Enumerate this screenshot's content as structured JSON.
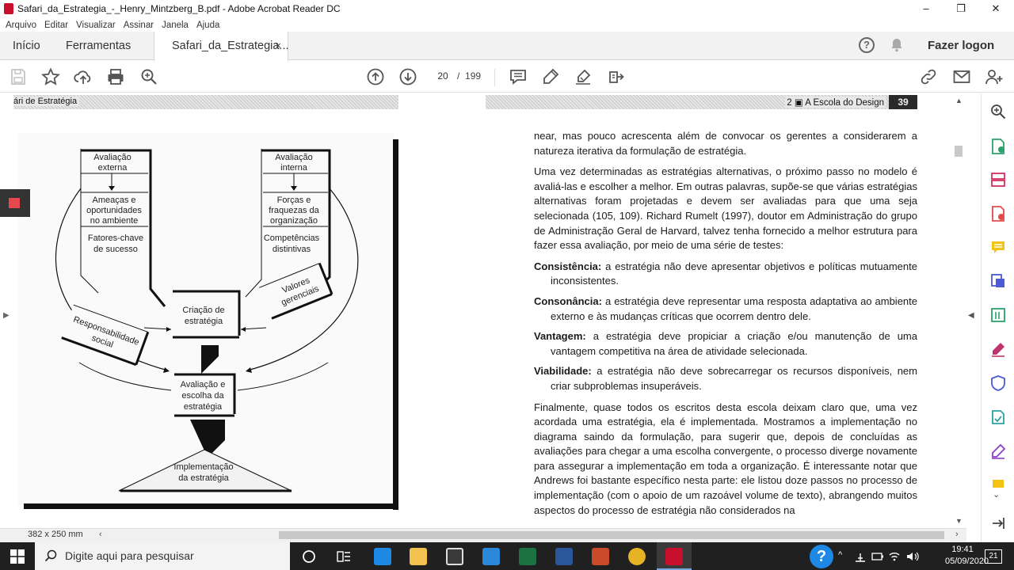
{
  "window": {
    "title": "Safari_da_Estrategia_-_Henry_Mintzberg_B.pdf - Adobe Acrobat Reader DC",
    "minimize": "–",
    "maximize": "❐",
    "close": "✕"
  },
  "menu": [
    "Arquivo",
    "Editar",
    "Visualizar",
    "Assinar",
    "Janela",
    "Ajuda"
  ],
  "tabs": {
    "home": "Início",
    "tools": "Ferramentas",
    "document": "Safari_da_Estrategia...",
    "close": "×",
    "help": "?",
    "login": "Fazer logon"
  },
  "toolbar": {
    "current_page": "20",
    "page_separator": "/",
    "total_pages": "199"
  },
  "document": {
    "left_running_head": "ári de Estratégia",
    "right_running_head": "2 ▣ A Escola do Design",
    "right_page_number": "39",
    "diagram": {
      "eval_external": [
        "Avaliação",
        "externa"
      ],
      "threats": [
        "Ameaças e",
        "oportunidades",
        "no ambiente"
      ],
      "key_factors": [
        "Fatores-chave",
        "de sucesso"
      ],
      "eval_internal": [
        "Avaliação",
        "interna"
      ],
      "strengths": [
        "Forças e",
        "fraquezas da",
        "organização"
      ],
      "competencies": [
        "Competências",
        "distintivas"
      ],
      "social": [
        "Responsabilidade",
        "social"
      ],
      "values": [
        "Valores",
        "gerenciais"
      ],
      "creation": [
        "Criação de",
        "estratégia"
      ],
      "evaluation": [
        "Avaliação e",
        "escolha da",
        "estratégia"
      ],
      "implementation": [
        "Implementação",
        "da estratégia"
      ]
    },
    "paragraphs": [
      "near, mas pouco acrescenta além de convocar os gerentes a considerarem a natureza iterativa da formulação de estratégia.",
      "Uma vez determinadas as estratégias alternativas, o próximo passo no modelo é avaliá-las e escolher a melhor. Em outras palavras, supõe-se que várias estratégias alternativas foram projetadas e devem ser avaliadas para que uma seja selecionada (105, 109). Richard Rumelt (1997), doutor em Administração do grupo de Administração Geral de Harvard, talvez tenha fornecido a melhor estrutura para fazer essa avaliação, por meio de uma série de testes:"
    ],
    "tests": [
      {
        "term": "Consistência:",
        "text": " a estratégia não deve apresentar objetivos e políticas mutuamente inconsistentes."
      },
      {
        "term": "Consonância:",
        "text": " a estratégia deve representar uma resposta adaptativa ao ambiente externo e às mudanças críticas que ocorrem dentro dele."
      },
      {
        "term": "Vantagem:",
        "text": " a estratégia deve propiciar a criação e/ou manutenção de uma vantagem competitiva na área de atividade selecionada."
      },
      {
        "term": "Viabilidade:",
        "text": " a estratégia não deve sobrecarregar os recursos disponíveis, nem criar subproblemas insuperáveis."
      }
    ],
    "final_paragraph": "Finalmente, quase todos os escritos desta escola deixam claro que, uma vez acordada uma estratégia, ela é implementada. Mostramos a implementação no diagrama saindo da formulação, para sugerir que, depois de concluídas as avaliações para chegar a uma escolha convergente, o processo diverge novamente para assegurar a implementação em toda a organização. É interessante notar que Andrews foi bastante específico nesta parte: ele listou doze passos no processo de implementação (com o apoio de um razoável volume de texto), abrangendo muitos aspectos do processo de estratégia não considerados na"
  },
  "status": {
    "page_size": "382 x 250 mm"
  },
  "taskbar": {
    "search_placeholder": "Digite aqui para pesquisar",
    "time": "19:41",
    "date": "05/09/2020",
    "notifications": "21"
  },
  "colors": {
    "acrobat_red": "#c8102e",
    "taskbar": "#202020"
  }
}
